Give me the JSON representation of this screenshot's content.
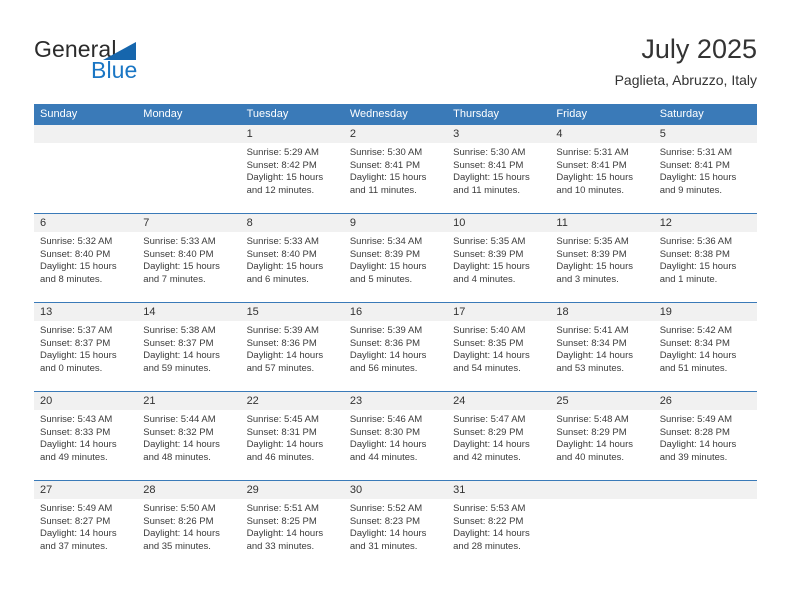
{
  "brand": {
    "name_part1": "General",
    "name_part2": "Blue",
    "triangle_icon": "triangle-icon",
    "color_dark": "#2b2b2b",
    "color_blue": "#1a76c4"
  },
  "header": {
    "title": "July 2025",
    "subtitle": "Paglieta, Abruzzo, Italy"
  },
  "theme": {
    "header_blue": "#3a7ab8",
    "day_band_gray": "#f1f1f1",
    "text": "#333333"
  },
  "weekdays": [
    "Sunday",
    "Monday",
    "Tuesday",
    "Wednesday",
    "Thursday",
    "Friday",
    "Saturday"
  ],
  "weeks": [
    [
      {
        "day": "",
        "lines": []
      },
      {
        "day": "",
        "lines": []
      },
      {
        "day": "1",
        "lines": [
          "Sunrise: 5:29 AM",
          "Sunset: 8:42 PM",
          "Daylight: 15 hours",
          "and 12 minutes."
        ]
      },
      {
        "day": "2",
        "lines": [
          "Sunrise: 5:30 AM",
          "Sunset: 8:41 PM",
          "Daylight: 15 hours",
          "and 11 minutes."
        ]
      },
      {
        "day": "3",
        "lines": [
          "Sunrise: 5:30 AM",
          "Sunset: 8:41 PM",
          "Daylight: 15 hours",
          "and 11 minutes."
        ]
      },
      {
        "day": "4",
        "lines": [
          "Sunrise: 5:31 AM",
          "Sunset: 8:41 PM",
          "Daylight: 15 hours",
          "and 10 minutes."
        ]
      },
      {
        "day": "5",
        "lines": [
          "Sunrise: 5:31 AM",
          "Sunset: 8:41 PM",
          "Daylight: 15 hours",
          "and 9 minutes."
        ]
      }
    ],
    [
      {
        "day": "6",
        "lines": [
          "Sunrise: 5:32 AM",
          "Sunset: 8:40 PM",
          "Daylight: 15 hours",
          "and 8 minutes."
        ]
      },
      {
        "day": "7",
        "lines": [
          "Sunrise: 5:33 AM",
          "Sunset: 8:40 PM",
          "Daylight: 15 hours",
          "and 7 minutes."
        ]
      },
      {
        "day": "8",
        "lines": [
          "Sunrise: 5:33 AM",
          "Sunset: 8:40 PM",
          "Daylight: 15 hours",
          "and 6 minutes."
        ]
      },
      {
        "day": "9",
        "lines": [
          "Sunrise: 5:34 AM",
          "Sunset: 8:39 PM",
          "Daylight: 15 hours",
          "and 5 minutes."
        ]
      },
      {
        "day": "10",
        "lines": [
          "Sunrise: 5:35 AM",
          "Sunset: 8:39 PM",
          "Daylight: 15 hours",
          "and 4 minutes."
        ]
      },
      {
        "day": "11",
        "lines": [
          "Sunrise: 5:35 AM",
          "Sunset: 8:39 PM",
          "Daylight: 15 hours",
          "and 3 minutes."
        ]
      },
      {
        "day": "12",
        "lines": [
          "Sunrise: 5:36 AM",
          "Sunset: 8:38 PM",
          "Daylight: 15 hours",
          "and 1 minute."
        ]
      }
    ],
    [
      {
        "day": "13",
        "lines": [
          "Sunrise: 5:37 AM",
          "Sunset: 8:37 PM",
          "Daylight: 15 hours",
          "and 0 minutes."
        ]
      },
      {
        "day": "14",
        "lines": [
          "Sunrise: 5:38 AM",
          "Sunset: 8:37 PM",
          "Daylight: 14 hours",
          "and 59 minutes."
        ]
      },
      {
        "day": "15",
        "lines": [
          "Sunrise: 5:39 AM",
          "Sunset: 8:36 PM",
          "Daylight: 14 hours",
          "and 57 minutes."
        ]
      },
      {
        "day": "16",
        "lines": [
          "Sunrise: 5:39 AM",
          "Sunset: 8:36 PM",
          "Daylight: 14 hours",
          "and 56 minutes."
        ]
      },
      {
        "day": "17",
        "lines": [
          "Sunrise: 5:40 AM",
          "Sunset: 8:35 PM",
          "Daylight: 14 hours",
          "and 54 minutes."
        ]
      },
      {
        "day": "18",
        "lines": [
          "Sunrise: 5:41 AM",
          "Sunset: 8:34 PM",
          "Daylight: 14 hours",
          "and 53 minutes."
        ]
      },
      {
        "day": "19",
        "lines": [
          "Sunrise: 5:42 AM",
          "Sunset: 8:34 PM",
          "Daylight: 14 hours",
          "and 51 minutes."
        ]
      }
    ],
    [
      {
        "day": "20",
        "lines": [
          "Sunrise: 5:43 AM",
          "Sunset: 8:33 PM",
          "Daylight: 14 hours",
          "and 49 minutes."
        ]
      },
      {
        "day": "21",
        "lines": [
          "Sunrise: 5:44 AM",
          "Sunset: 8:32 PM",
          "Daylight: 14 hours",
          "and 48 minutes."
        ]
      },
      {
        "day": "22",
        "lines": [
          "Sunrise: 5:45 AM",
          "Sunset: 8:31 PM",
          "Daylight: 14 hours",
          "and 46 minutes."
        ]
      },
      {
        "day": "23",
        "lines": [
          "Sunrise: 5:46 AM",
          "Sunset: 8:30 PM",
          "Daylight: 14 hours",
          "and 44 minutes."
        ]
      },
      {
        "day": "24",
        "lines": [
          "Sunrise: 5:47 AM",
          "Sunset: 8:29 PM",
          "Daylight: 14 hours",
          "and 42 minutes."
        ]
      },
      {
        "day": "25",
        "lines": [
          "Sunrise: 5:48 AM",
          "Sunset: 8:29 PM",
          "Daylight: 14 hours",
          "and 40 minutes."
        ]
      },
      {
        "day": "26",
        "lines": [
          "Sunrise: 5:49 AM",
          "Sunset: 8:28 PM",
          "Daylight: 14 hours",
          "and 39 minutes."
        ]
      }
    ],
    [
      {
        "day": "27",
        "lines": [
          "Sunrise: 5:49 AM",
          "Sunset: 8:27 PM",
          "Daylight: 14 hours",
          "and 37 minutes."
        ]
      },
      {
        "day": "28",
        "lines": [
          "Sunrise: 5:50 AM",
          "Sunset: 8:26 PM",
          "Daylight: 14 hours",
          "and 35 minutes."
        ]
      },
      {
        "day": "29",
        "lines": [
          "Sunrise: 5:51 AM",
          "Sunset: 8:25 PM",
          "Daylight: 14 hours",
          "and 33 minutes."
        ]
      },
      {
        "day": "30",
        "lines": [
          "Sunrise: 5:52 AM",
          "Sunset: 8:23 PM",
          "Daylight: 14 hours",
          "and 31 minutes."
        ]
      },
      {
        "day": "31",
        "lines": [
          "Sunrise: 5:53 AM",
          "Sunset: 8:22 PM",
          "Daylight: 14 hours",
          "and 28 minutes."
        ]
      },
      {
        "day": "",
        "lines": []
      },
      {
        "day": "",
        "lines": []
      }
    ]
  ]
}
